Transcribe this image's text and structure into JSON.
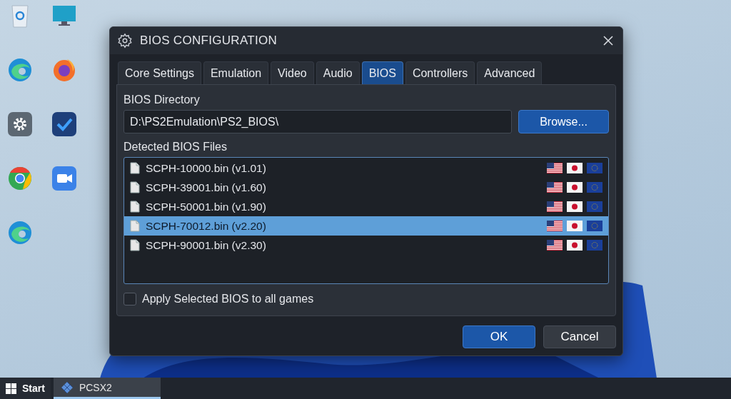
{
  "window": {
    "title": "BIOS CONFIGURATION"
  },
  "tabs": [
    {
      "label": "Core Settings",
      "selected": false
    },
    {
      "label": "Emulation",
      "selected": false
    },
    {
      "label": "Video",
      "selected": false
    },
    {
      "label": "Audio",
      "selected": false
    },
    {
      "label": "BIOS",
      "selected": true
    },
    {
      "label": "Controllers",
      "selected": false
    },
    {
      "label": "Advanced",
      "selected": false
    }
  ],
  "bios_directory": {
    "label": "BIOS Directory",
    "value": "D:\\PS2Emulation\\PS2_BIOS\\",
    "button": "Browse..."
  },
  "bios_files": {
    "label": "Detected BIOS Files",
    "rows": [
      {
        "name": "SCPH-10000.bin (v1.01)",
        "selected": false
      },
      {
        "name": "SCPH-39001.bin (v1.60)",
        "selected": false
      },
      {
        "name": "SCPH-50001.bin (v1.90)",
        "selected": false
      },
      {
        "name": "SCPH-70012.bin (v2.20)",
        "selected": true
      },
      {
        "name": "SCPH-90001.bin (v2.30)",
        "selected": false
      }
    ]
  },
  "apply_all": {
    "label": "Apply Selected BIOS to all games",
    "checked": false
  },
  "buttons": [
    {
      "label": "OK",
      "kind": "primary"
    },
    {
      "label": "Cancel",
      "kind": "secondary"
    }
  ],
  "taskbar": {
    "start": "Start",
    "apps": [
      {
        "label": "PCSX2",
        "selected": true
      }
    ]
  }
}
